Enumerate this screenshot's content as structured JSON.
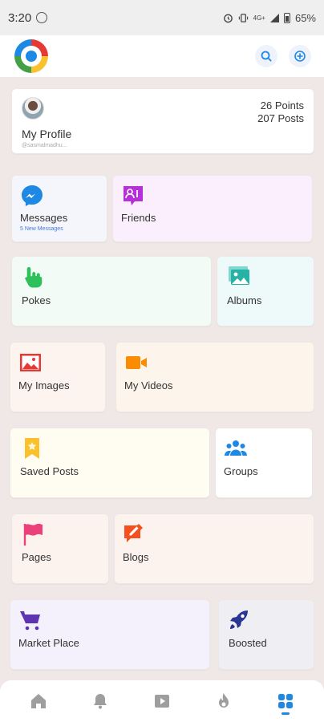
{
  "status_bar": {
    "time": "3:20",
    "network": "4G+",
    "battery": "65%"
  },
  "header": {
    "search_icon": "search-icon",
    "add_icon": "add-circle-icon"
  },
  "profile": {
    "label": "My Profile",
    "username": "@sasmalmadhu...",
    "points": "26 Points",
    "posts": "207 Posts"
  },
  "tiles": {
    "messages": {
      "label": "Messages",
      "sub": "5 New Messages",
      "icon": "messenger-icon"
    },
    "friends": {
      "label": "Friends",
      "icon": "friends-icon"
    },
    "pokes": {
      "label": "Pokes",
      "icon": "poke-hand-icon"
    },
    "albums": {
      "label": "Albums",
      "icon": "albums-icon"
    },
    "my_images": {
      "label": "My Images",
      "icon": "image-icon"
    },
    "my_videos": {
      "label": "My Videos",
      "icon": "video-camera-icon"
    },
    "saved_posts": {
      "label": "Saved Posts",
      "icon": "bookmark-star-icon"
    },
    "groups": {
      "label": "Groups",
      "icon": "groups-icon"
    },
    "pages": {
      "label": "Pages",
      "icon": "flag-icon"
    },
    "blogs": {
      "label": "Blogs",
      "icon": "blog-edit-icon"
    },
    "market_place": {
      "label": "Market Place",
      "icon": "cart-icon"
    },
    "boosted": {
      "label": "Boosted",
      "icon": "rocket-icon"
    }
  },
  "bottom_nav": {
    "items": [
      "home-icon",
      "bell-icon",
      "play-icon",
      "fire-icon",
      "grid-icon"
    ],
    "active": "grid-icon"
  },
  "colors": {
    "accent": "#1e88e5",
    "messages_blue": "#1e88e5",
    "friends_purple": "#b62fd8",
    "pokes_green": "#2ec05a",
    "albums_teal": "#26b3a6",
    "images_red": "#e53935",
    "videos_orange": "#fb8c00",
    "saved_yellow": "#fbc02d",
    "groups_blue": "#1e88e5",
    "pages_pink": "#ec407a",
    "blogs_red": "#f4511e",
    "market_purple": "#5e35b1",
    "boosted_navy": "#283593"
  }
}
